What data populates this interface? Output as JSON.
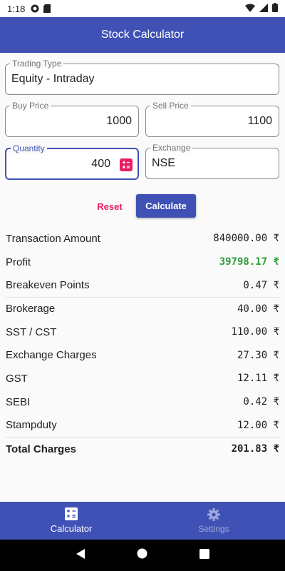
{
  "status_bar": {
    "time": "1:18",
    "icons": [
      "pocket-casts-icon",
      "sd-card-icon",
      "wifi-icon",
      "signal-icon",
      "battery-icon"
    ]
  },
  "app_bar": {
    "title": "Stock Calculator",
    "color": "#3f51b5"
  },
  "form": {
    "trading_type": {
      "label": "Trading Type",
      "value": "Equity - Intraday"
    },
    "buy_price": {
      "label": "Buy Price",
      "value": "1000"
    },
    "sell_price": {
      "label": "Sell Price",
      "value": "1100"
    },
    "quantity": {
      "label": "Quantity",
      "value": "400",
      "icon": "calculator-icon"
    },
    "exchange": {
      "label": "Exchange",
      "value": "NSE"
    }
  },
  "actions": {
    "reset_label": "Reset",
    "calculate_label": "Calculate"
  },
  "results": {
    "transaction_amount": {
      "label": "Transaction Amount",
      "value": "840000.00 ₹"
    },
    "profit": {
      "label": "Profit",
      "value": "39798.17 ₹",
      "color": "#2e9e3c"
    },
    "breakeven_points": {
      "label": "Breakeven Points",
      "value": "0.47 ₹"
    },
    "brokerage": {
      "label": "Brokerage",
      "value": "40.00 ₹"
    },
    "sst_cst": {
      "label": "SST / CST",
      "value": "110.00 ₹"
    },
    "exchange_charges": {
      "label": "Exchange Charges",
      "value": "27.30 ₹"
    },
    "gst": {
      "label": "GST",
      "value": "12.11 ₹"
    },
    "sebi": {
      "label": "SEBI",
      "value": "0.42 ₹"
    },
    "stampduty": {
      "label": "Stampduty",
      "value": "12.00 ₹"
    },
    "total_charges": {
      "label": "Total Charges",
      "value": "201.83 ₹"
    }
  },
  "bottom_nav": {
    "calculator": {
      "label": "Calculator",
      "icon": "calculator-icon",
      "active": true
    },
    "settings": {
      "label": "Settings",
      "icon": "gear-icon",
      "active": false
    }
  },
  "accent_color": "#e91e63"
}
